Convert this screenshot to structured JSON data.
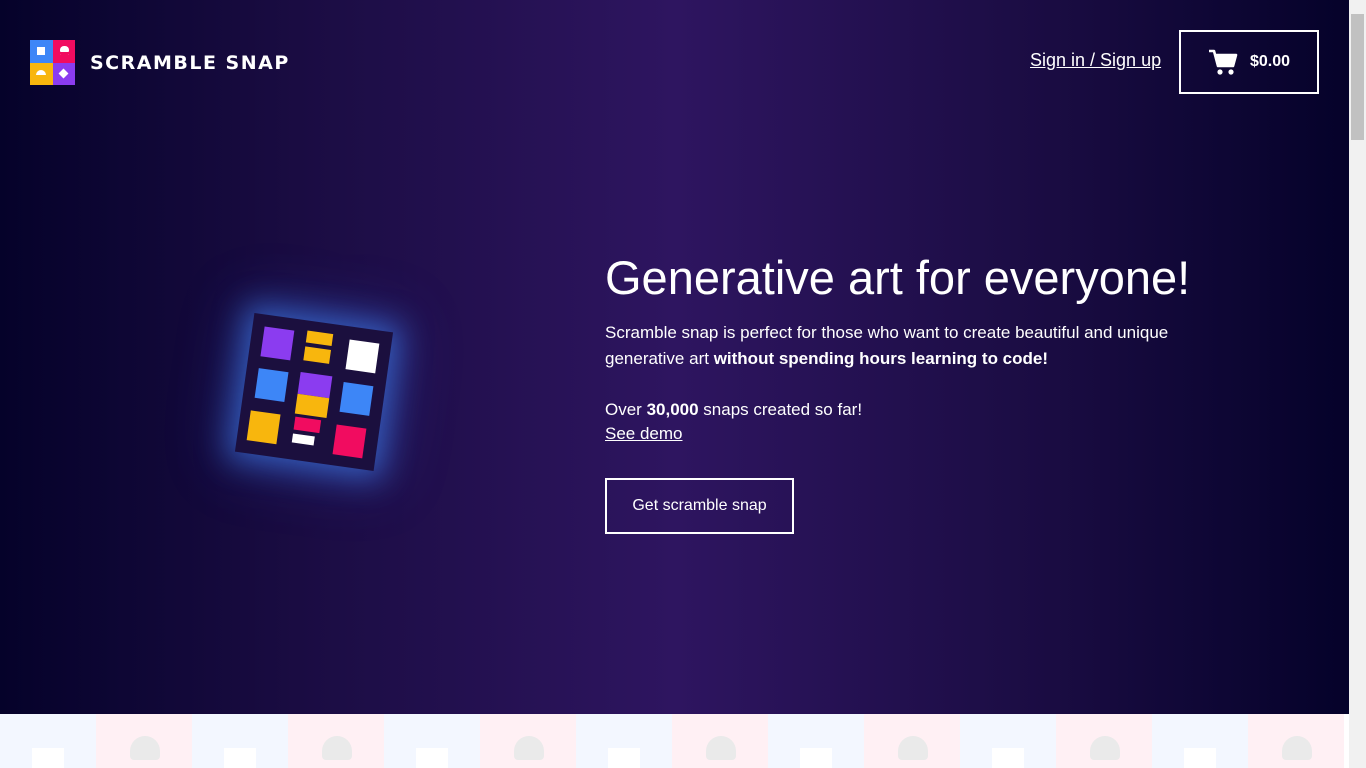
{
  "header": {
    "brand_name": "SCRAMBLE SNAP",
    "signin_label": "Sign in / Sign up",
    "cart_total": "$0.00"
  },
  "hero": {
    "title": "Generative art for everyone!",
    "description_start": "Scramble snap is perfect for those who want to create beautiful and unique generative art ",
    "description_bold": "without spending hours learning to code!",
    "snaps_prefix": "Over ",
    "snaps_count": "30,000",
    "snaps_suffix": " snaps created so far!",
    "demo_link": "See demo",
    "cta_label": "Get scramble snap"
  },
  "colors": {
    "brand_blue": "#3d86f7",
    "brand_pink": "#f10c60",
    "brand_yellow": "#f8b60d",
    "brand_purple": "#8b3cf0",
    "hero_bg": "#2e1560"
  },
  "icons": {
    "cart": "shopping-cart-icon",
    "logo": "scramble-snap-logo"
  }
}
